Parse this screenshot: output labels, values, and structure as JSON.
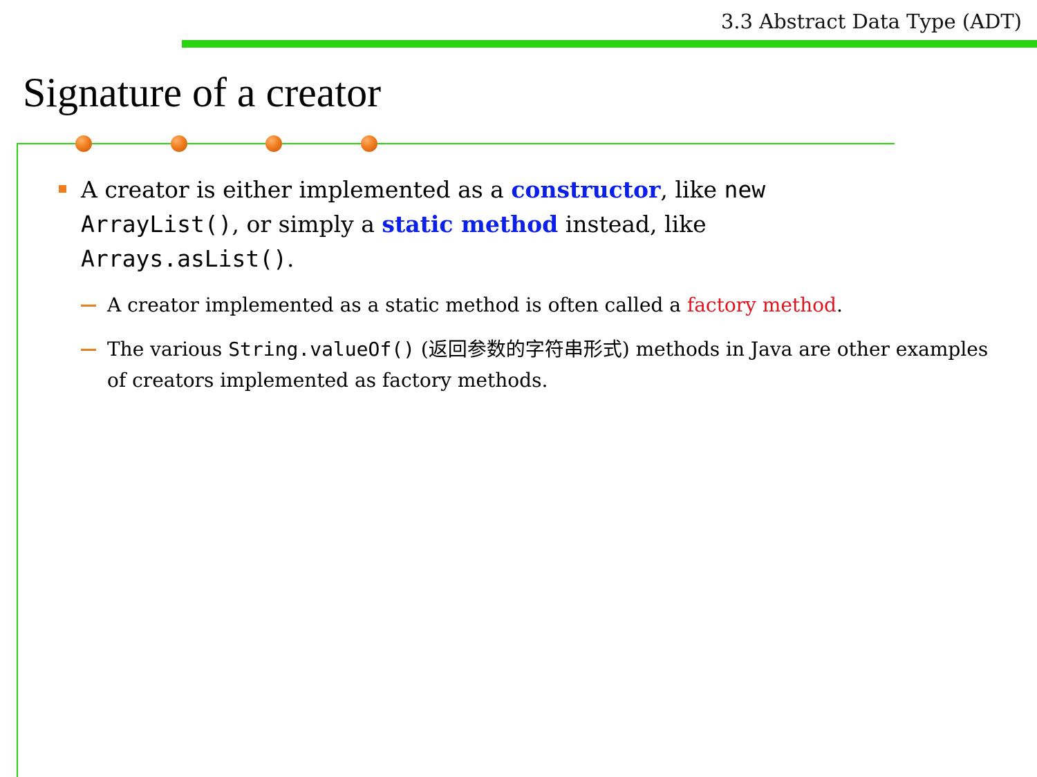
{
  "header": {
    "section_title": "3.3 Abstract Data Type (ADT)",
    "accent_color": "#2ad40e"
  },
  "slide": {
    "title": "Signature of a creator",
    "dot_color": "#f07d1f"
  },
  "bullet1": {
    "t1": "A creator is either implemented as a ",
    "kw1": "constructor",
    "t2": ", like ",
    "code1": "new ArrayList()",
    "t3": ", or simply a ",
    "kw2": "static method",
    "t4": " instead, like ",
    "code2": "Arrays.asList()",
    "t5": "."
  },
  "sub1": {
    "t1": "A creator implemented as a static method is often called a ",
    "highlight": "factory method",
    "t2": "."
  },
  "sub2": {
    "t1": "The various ",
    "code": "String.valueOf()",
    "t2": " (返回参数的字符串形式) methods in Java are other examples of creators implemented as factory methods."
  }
}
